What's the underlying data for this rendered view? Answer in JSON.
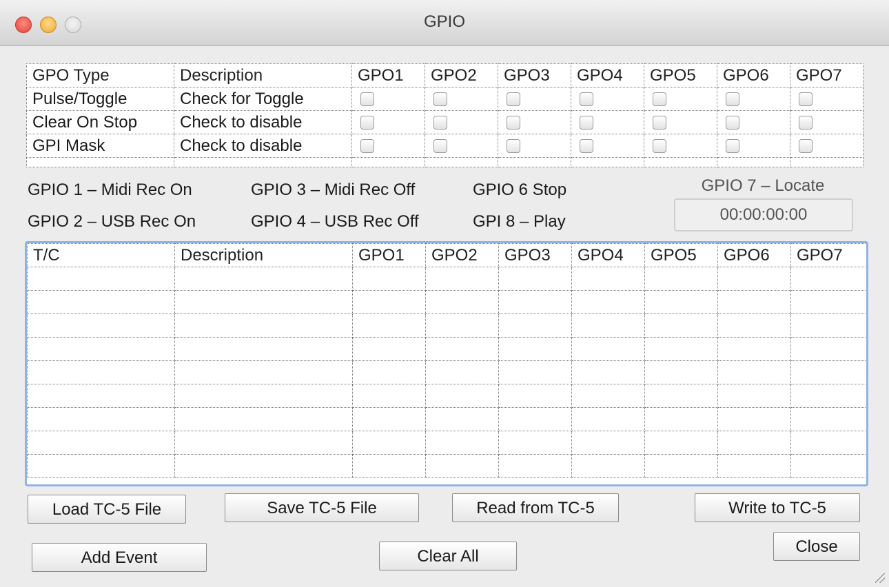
{
  "window": {
    "title": "GPIO"
  },
  "gpo_table": {
    "headers": [
      "GPO Type",
      "Description",
      "GPO1",
      "GPO2",
      "GPO3",
      "GPO4",
      "GPO5",
      "GPO6",
      "GPO7"
    ],
    "rows": [
      {
        "type": "Pulse/Toggle",
        "description": "Check for Toggle",
        "checks": [
          false,
          false,
          false,
          false,
          false,
          false,
          false
        ]
      },
      {
        "type": "Clear On Stop",
        "description": "Check to disable",
        "checks": [
          false,
          false,
          false,
          false,
          false,
          false,
          false
        ]
      },
      {
        "type": "GPI Mask",
        "description": "Check to disable",
        "checks": [
          false,
          false,
          false,
          false,
          false,
          false,
          false
        ]
      }
    ]
  },
  "legend": {
    "gpio1": "GPIO 1 – Midi Rec On",
    "gpio2": "GPIO 2 – USB Rec On",
    "gpio3": "GPIO 3 – Midi Rec Off",
    "gpio4": "GPIO 4 – USB Rec Off",
    "gpio6": "GPIO 6 Stop",
    "gpi8": "GPI 8 – Play"
  },
  "locate": {
    "label": "GPIO 7 – Locate",
    "value": "00:00:00:00"
  },
  "events_table": {
    "headers": [
      "T/C",
      "Description",
      "GPO1",
      "GPO2",
      "GPO3",
      "GPO4",
      "GPO5",
      "GPO6",
      "GPO7"
    ]
  },
  "buttons": {
    "load": "Load TC-5 File",
    "save": "Save TC-5 File",
    "read": "Read from TC-5",
    "write": "Write to TC-5",
    "add_event": "Add Event",
    "clear_all": "Clear All",
    "close": "Close"
  }
}
